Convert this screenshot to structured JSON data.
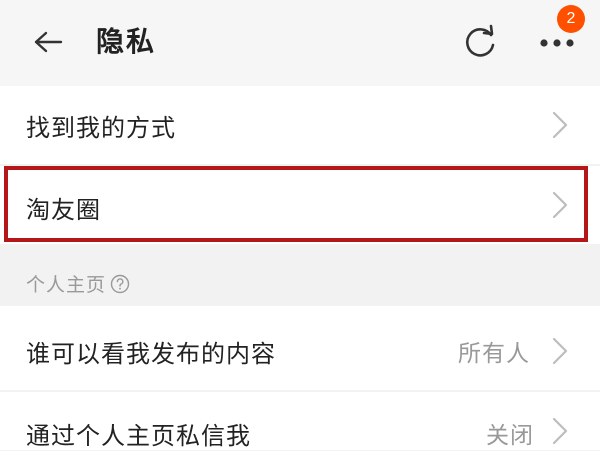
{
  "header": {
    "title": "隐私",
    "badge_count": "2",
    "icons": {
      "back": "back-arrow-icon",
      "refresh": "refresh-icon",
      "more": "more-dots-icon"
    }
  },
  "rows": [
    {
      "label": "找到我的方式",
      "value": ""
    },
    {
      "label": "淘友圈",
      "value": ""
    },
    {
      "label": "谁可以看我发布的内容",
      "value": "所有人"
    },
    {
      "label": "通过个人主页私信我",
      "value": "关闭"
    }
  ],
  "section": {
    "label": "个人主页"
  },
  "colors": {
    "background": "#f2f2f2",
    "accent": "#ff5000",
    "highlight_border": "#b5161a",
    "secondary_text": "#999999"
  }
}
